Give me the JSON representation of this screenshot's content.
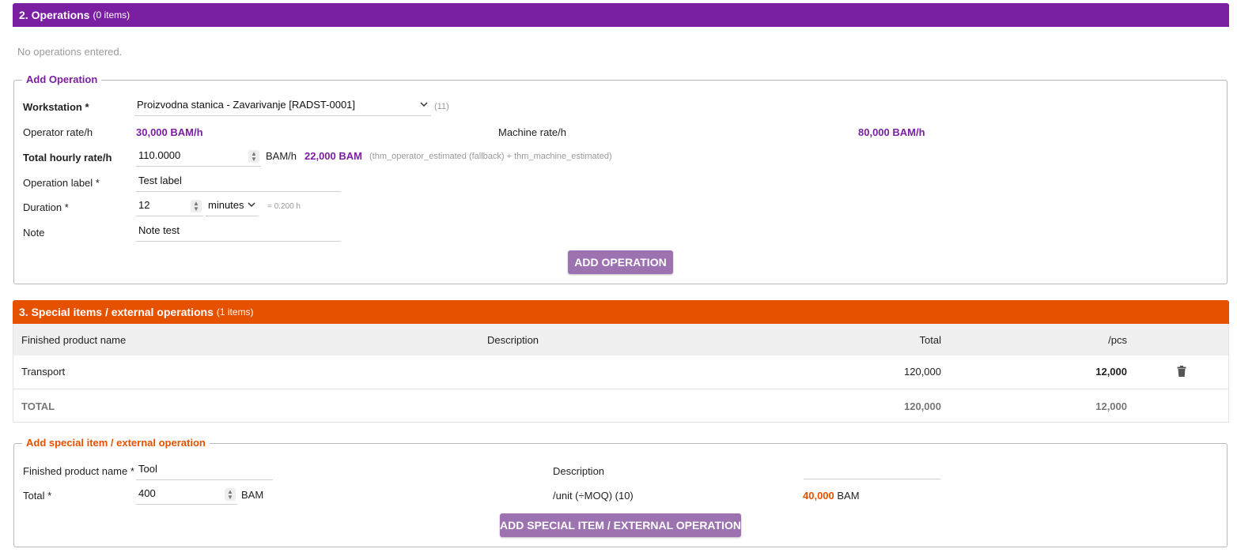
{
  "operations": {
    "title": "2. Operations",
    "count": "(0 items)",
    "empty_text": "No operations entered.",
    "color": "#7b1fa2"
  },
  "add_operation": {
    "legend": "Add Operation",
    "workstation_label": "Workstation *",
    "workstation_value": "Proizvodna stanica - Zavarivanje [RADST-0001]",
    "workstation_count": "(11)",
    "operator_rate_label": "Operator rate/h",
    "operator_rate_value": "30,000 BAM/h",
    "machine_rate_label": "Machine rate/h",
    "machine_rate_value": "80,000 BAM/h",
    "total_rate_label": "Total hourly rate/h",
    "total_rate_value": "110.0000",
    "total_rate_unit": "BAM/h",
    "total_amount": "22,000 BAM",
    "formula_hint": "(thm_operator_estimated (fallback) + thm_machine_estimated)",
    "operation_label_label": "Operation label *",
    "operation_label_value": "Test label",
    "duration_label": "Duration *",
    "duration_value": "12",
    "duration_unit": "minutes",
    "duration_hours": "= 0.200 h",
    "note_label": "Note",
    "note_value": "Note test",
    "button_label": "ADD OPERATION"
  },
  "special": {
    "title": "3. Special items / external operations",
    "count": "(1 items)",
    "color": "#e65100",
    "columns": [
      "Finished product name",
      "Description",
      "Total",
      "/pcs"
    ],
    "rows": [
      {
        "name": "Transport",
        "description": "",
        "total": "120,000",
        "per_pcs": "12,000"
      }
    ],
    "total_row": {
      "label": "TOTAL",
      "total": "120,000",
      "per_pcs": "12,000"
    }
  },
  "add_special": {
    "legend": "Add special item / external operation",
    "name_label": "Finished product name *",
    "name_value": "Tool",
    "description_label": "Description",
    "description_value": "",
    "total_label": "Total *",
    "total_value": "400",
    "total_unit": "BAM",
    "per_unit_label": "/unit (÷MOQ) (10)",
    "per_unit_value": "40,000",
    "per_unit_currency": "BAM",
    "button_label": "ADD SPECIAL ITEM / EXTERNAL OPERATION"
  }
}
